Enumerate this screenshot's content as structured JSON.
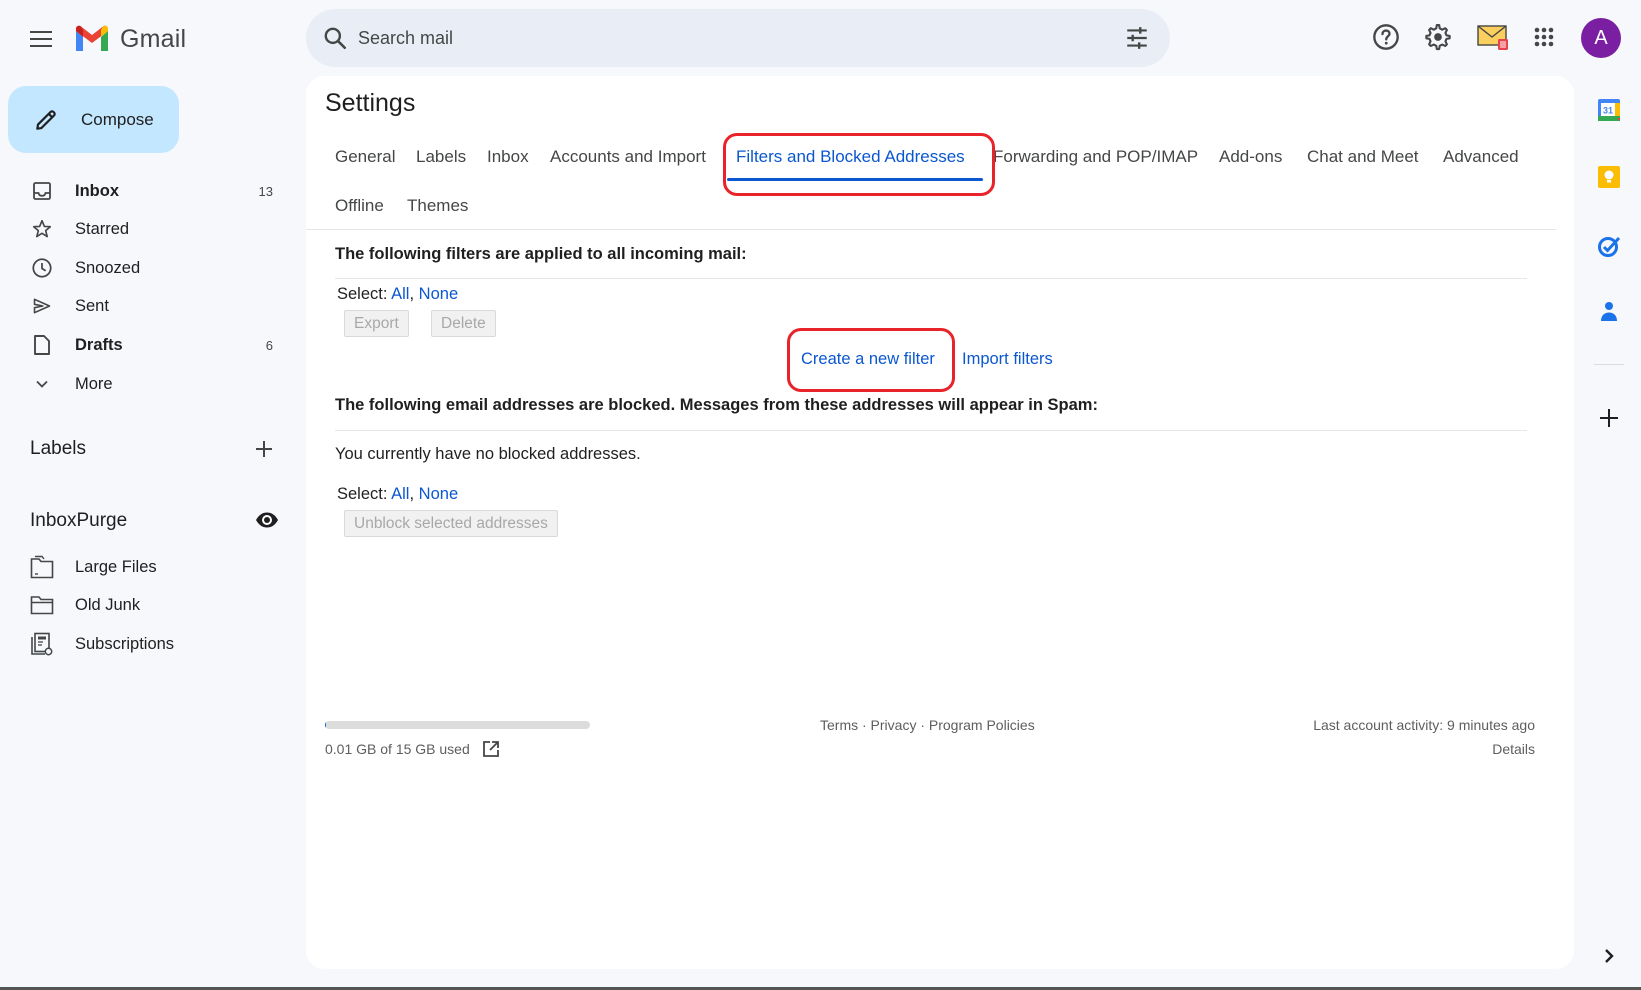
{
  "app": {
    "name": "Gmail",
    "search_placeholder": "Search mail",
    "avatar_initial": "A",
    "colors": {
      "accent": "#0b57d0",
      "compose_bg": "#c2e7ff",
      "avatar_bg": "#7b1fa2",
      "highlight_box": "#e8232a"
    }
  },
  "topbar": {
    "icons": [
      "menu-icon",
      "search-icon",
      "search-options-icon",
      "help-icon",
      "settings-icon",
      "inboxpurge-icon",
      "apps-icon"
    ]
  },
  "sidebar": {
    "compose_label": "Compose",
    "items": [
      {
        "label": "Inbox",
        "count": "13",
        "bold": true,
        "icon": "inbox-icon"
      },
      {
        "label": "Starred",
        "count": "",
        "bold": false,
        "icon": "star-icon"
      },
      {
        "label": "Snoozed",
        "count": "",
        "bold": false,
        "icon": "clock-icon"
      },
      {
        "label": "Sent",
        "count": "",
        "bold": false,
        "icon": "send-icon"
      },
      {
        "label": "Drafts",
        "count": "6",
        "bold": true,
        "icon": "draft-icon"
      },
      {
        "label": "More",
        "count": "",
        "bold": false,
        "icon": "chevron-down-icon"
      }
    ],
    "labels_heading": "Labels",
    "extension_heading": "InboxPurge",
    "extension_items": [
      {
        "label": "Large Files",
        "icon": "large-files-folder-icon"
      },
      {
        "label": "Old Junk",
        "icon": "folder-icon"
      },
      {
        "label": "Subscriptions",
        "icon": "subscriptions-icon"
      }
    ]
  },
  "settings": {
    "title": "Settings",
    "tabs": [
      {
        "label": "General",
        "active": false
      },
      {
        "label": "Labels",
        "active": false
      },
      {
        "label": "Inbox",
        "active": false
      },
      {
        "label": "Accounts and Import",
        "active": false
      },
      {
        "label": "Filters and Blocked Addresses",
        "active": true
      },
      {
        "label": "Forwarding and POP/IMAP",
        "active": false
      },
      {
        "label": "Add-ons",
        "active": false
      },
      {
        "label": "Chat and Meet",
        "active": false
      },
      {
        "label": "Advanced",
        "active": false
      },
      {
        "label": "Offline",
        "active": false
      },
      {
        "label": "Themes",
        "active": false
      }
    ],
    "filters": {
      "heading": "The following filters are applied to all incoming mail:",
      "select_label": "Select:",
      "select_all": "All",
      "select_sep": ",",
      "select_none": "None",
      "export_label": "Export",
      "delete_label": "Delete",
      "create_filter_link": "Create a new filter",
      "import_filters_link": "Import filters"
    },
    "blocked": {
      "heading": "The following email addresses are blocked. Messages from these addresses will appear in Spam:",
      "empty_message": "You currently have no blocked addresses.",
      "select_label": "Select:",
      "select_all": "All",
      "select_sep": ",",
      "select_none": "None",
      "unblock_label": "Unblock selected addresses"
    }
  },
  "footer": {
    "storage_text": "0.01 GB of 15 GB used",
    "storage_used_fraction": 0.0007,
    "links": "Terms · Privacy · Program Policies",
    "last_activity": "Last account activity: 9 minutes ago",
    "details": "Details"
  },
  "right_rail": {
    "icons": [
      "calendar-icon",
      "keep-icon",
      "tasks-icon",
      "contacts-icon",
      "add-addon-icon",
      "expand-panel-icon"
    ],
    "calendar_day": "31"
  }
}
